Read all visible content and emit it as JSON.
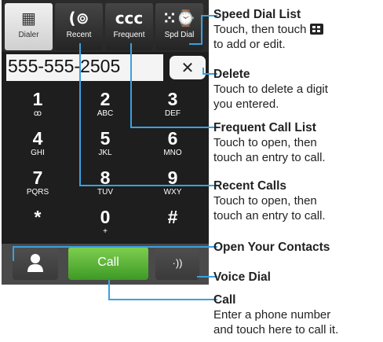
{
  "tabs": [
    {
      "label": "Dialer",
      "icon": "dialpad-grid-icon",
      "glyph": "▦",
      "active": true
    },
    {
      "label": "Recent",
      "icon": "recent-calls-icon",
      "glyph": "(⊚",
      "active": false
    },
    {
      "label": "Frequent",
      "icon": "frequent-calls-icon",
      "glyph": "ccc",
      "active": false
    },
    {
      "label": "Spd Dial",
      "icon": "speed-dial-icon",
      "glyph": "⁙⌚",
      "active": false
    }
  ],
  "display": {
    "number": "555-555-2505"
  },
  "delete": {
    "icon": "backspace-icon",
    "glyph": "✕"
  },
  "keypad": [
    {
      "digit": "1",
      "letters": "ꝏ",
      "voicemail_icon": "voicemail-icon"
    },
    {
      "digit": "2",
      "letters": "ABC"
    },
    {
      "digit": "3",
      "letters": "DEF"
    },
    {
      "digit": "4",
      "letters": "GHI"
    },
    {
      "digit": "5",
      "letters": "JKL"
    },
    {
      "digit": "6",
      "letters": "MNO"
    },
    {
      "digit": "7",
      "letters": "PQRS"
    },
    {
      "digit": "8",
      "letters": "TUV"
    },
    {
      "digit": "9",
      "letters": "WXY"
    },
    {
      "digit": "*",
      "letters": ""
    },
    {
      "digit": "0",
      "letters": "+"
    },
    {
      "digit": "#",
      "letters": ""
    }
  ],
  "bottom": {
    "call_label": "Call",
    "contacts_icon": "person-icon",
    "voice_icon": "voice-dial-icon",
    "voice_glyph": "·))"
  },
  "annotations": {
    "speed_dial": {
      "title": "Speed Dial List",
      "text1": "Touch, then touch",
      "text2": "to add or edit."
    },
    "delete": {
      "title": "Delete",
      "text1": "Touch to delete a digit",
      "text2": "you entered."
    },
    "frequent": {
      "title": "Frequent Call List",
      "text1": "Touch to open, then",
      "text2": "touch an entry to call."
    },
    "recent": {
      "title": "Recent Calls",
      "text1": "Touch to open, then",
      "text2": "touch an entry to call."
    },
    "contacts": {
      "title": "Open Your Contacts"
    },
    "voice": {
      "title": "Voice Dial"
    },
    "call": {
      "title": "Call",
      "text1": "Enter a phone number",
      "text2": "and touch here to call it."
    }
  },
  "colors": {
    "call_green": "#4caf2e",
    "leader_line": "#3aa0e0",
    "phone_bg": "#1e1e1e"
  }
}
